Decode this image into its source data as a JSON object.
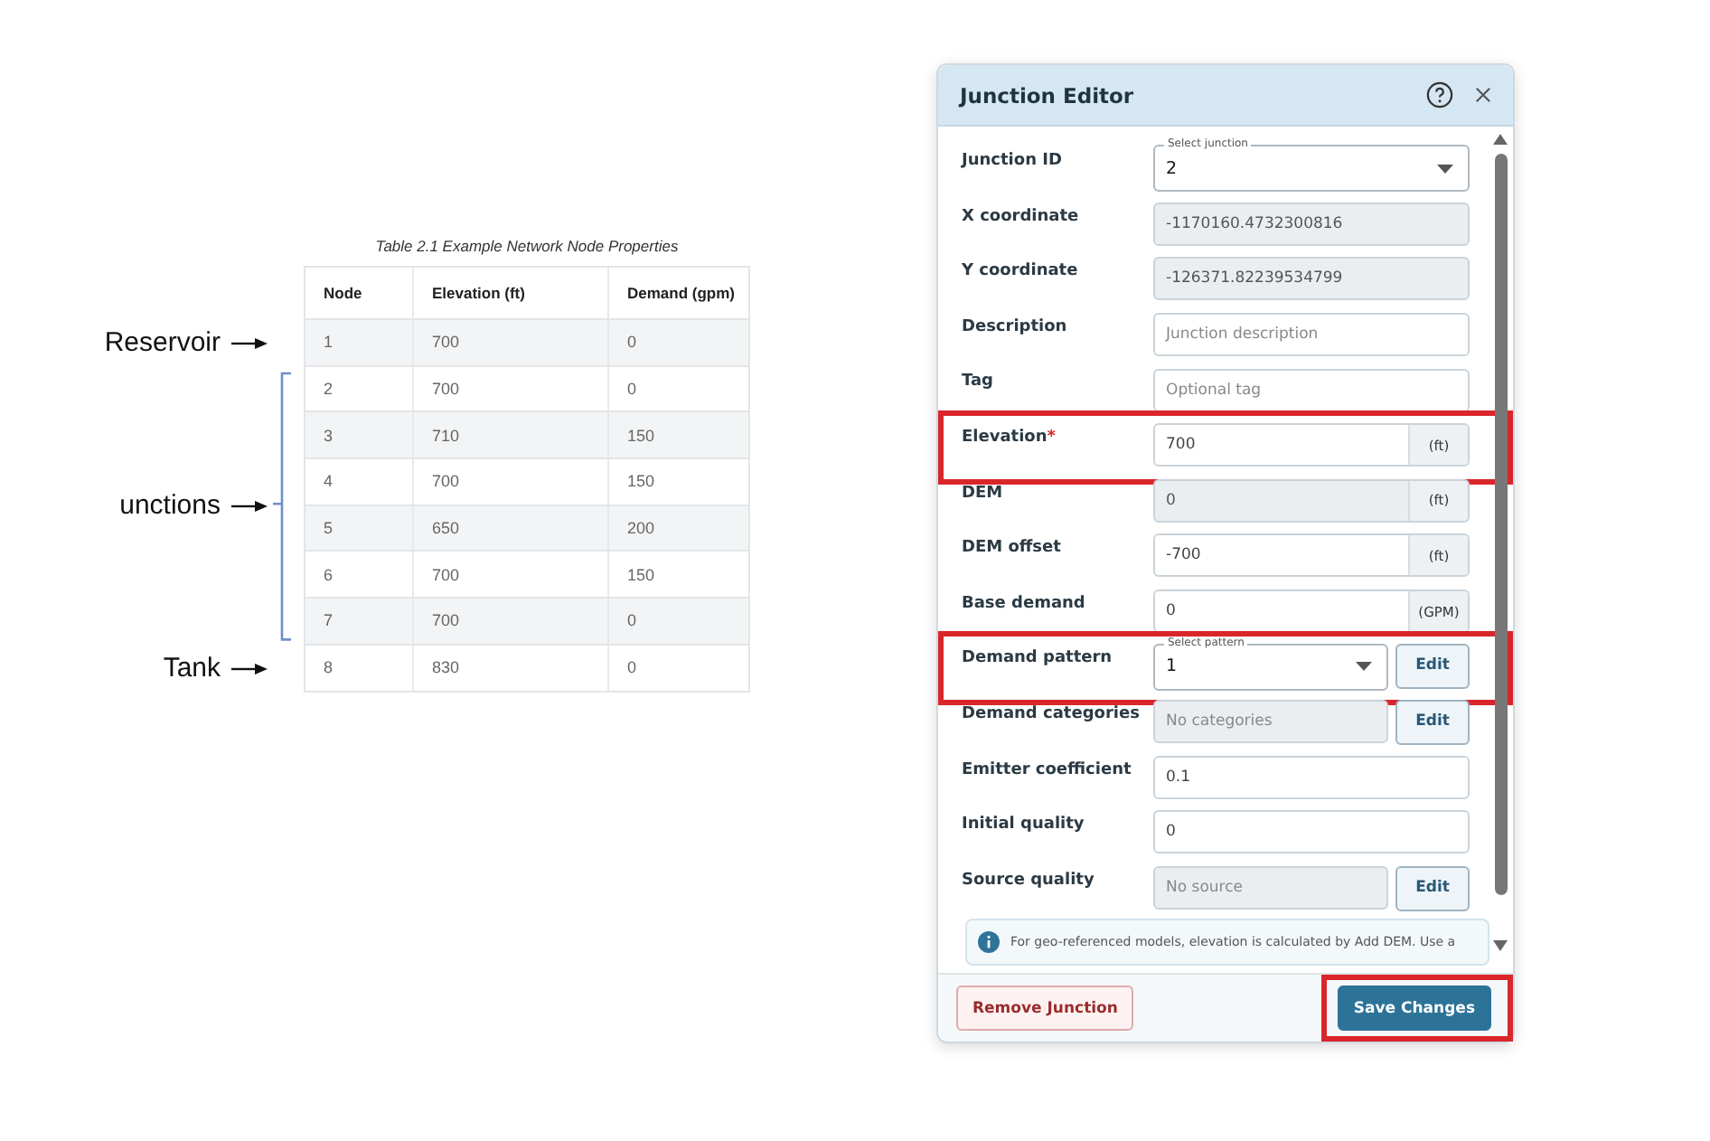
{
  "figure": {
    "caption": "Table 2.1 Example Network Node Properties",
    "columns": [
      "Node",
      "Elevation (ft)",
      "Demand (gpm)"
    ],
    "groups": [
      {
        "label": "Reservoir",
        "kind": "arrow",
        "rows": [
          [
            "1",
            "700",
            "0"
          ]
        ]
      },
      {
        "label": "unctions",
        "kind": "brace",
        "rows": [
          [
            "2",
            "700",
            "0"
          ],
          [
            "3",
            "710",
            "150"
          ],
          [
            "4",
            "700",
            "150"
          ],
          [
            "5",
            "650",
            "200"
          ],
          [
            "6",
            "700",
            "150"
          ],
          [
            "7",
            "700",
            "0"
          ]
        ]
      },
      {
        "label": "Tank",
        "kind": "arrow",
        "rows": [
          [
            "8",
            "830",
            "0"
          ]
        ]
      }
    ]
  },
  "dialog": {
    "title": "Junction Editor",
    "fields": [
      {
        "label": "Junction ID",
        "kind": "select",
        "floating_label": "Select junction",
        "value": "2",
        "highlighted": false
      },
      {
        "label": "X coordinate",
        "kind": "field",
        "disabled": true,
        "value": "-1170160.4732300816",
        "highlighted": false
      },
      {
        "label": "Y coordinate",
        "kind": "field",
        "disabled": true,
        "value": "-126371.82239534799",
        "highlighted": false
      },
      {
        "label": "Description",
        "kind": "field",
        "disabled": false,
        "placeholder": "Junction description",
        "highlighted": false
      },
      {
        "label": "Tag",
        "kind": "field",
        "disabled": false,
        "placeholder": "Optional tag",
        "highlighted": false
      },
      {
        "label": "Elevation",
        "marker": "*",
        "kind": "field",
        "disabled": false,
        "value": "700",
        "unit": "(ft)",
        "highlighted": true
      },
      {
        "label": "DEM",
        "kind": "field",
        "disabled": true,
        "value": "0",
        "unit": "(ft)",
        "highlighted": false
      },
      {
        "label": "DEM offset",
        "kind": "field",
        "disabled": false,
        "value": "-700",
        "unit": "(ft)",
        "highlighted": false
      },
      {
        "label": "Base demand",
        "kind": "field",
        "disabled": false,
        "value": "0",
        "unit": "(GPM)",
        "highlighted": false
      },
      {
        "label": "Demand pattern",
        "kind": "select",
        "floating_label": "Select pattern",
        "value": "1",
        "button": "Edit",
        "highlighted": true
      },
      {
        "label": "Demand categories",
        "kind": "field",
        "disabled": true,
        "placeholder": "No categories",
        "button": "Edit",
        "highlighted": false
      },
      {
        "label": "Emitter coefficient",
        "kind": "field",
        "disabled": false,
        "value": "0.1",
        "highlighted": false
      },
      {
        "label": "Initial quality",
        "kind": "field",
        "disabled": false,
        "value": "0",
        "highlighted": false
      },
      {
        "label": "Source quality",
        "kind": "field",
        "disabled": true,
        "placeholder": "No source",
        "button": "Edit",
        "highlighted": false
      }
    ],
    "info": "For geo-referenced models, elevation is calculated by Add DEM. Use a",
    "footer": [
      {
        "label": "Remove Junction",
        "kind": "danger",
        "highlighted": false
      },
      {
        "label": "Save Changes",
        "kind": "primary",
        "highlighted": true
      }
    ]
  }
}
